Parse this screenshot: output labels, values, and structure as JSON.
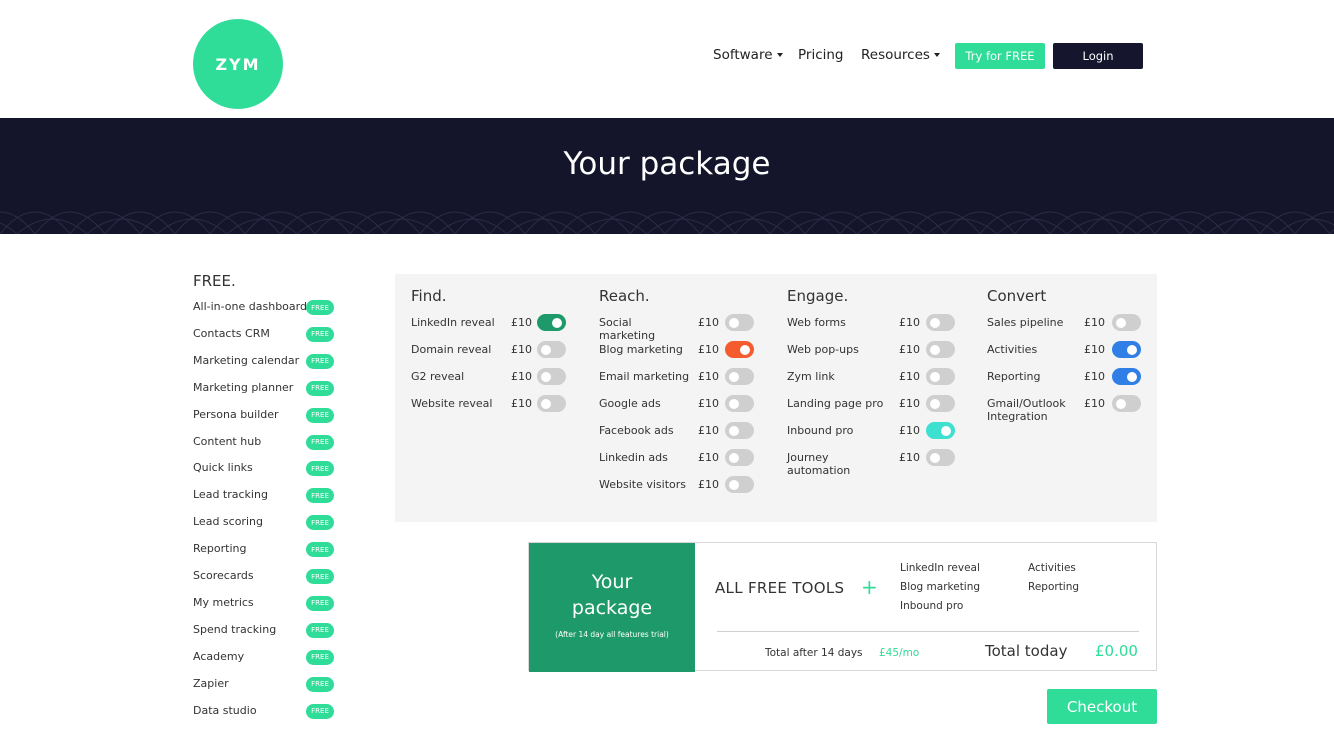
{
  "header": {
    "logo_text": "ZYM",
    "nav": {
      "software": "Software",
      "pricing": "Pricing",
      "resources": "Resources"
    },
    "try_button": "Try for FREE",
    "login_button": "Login"
  },
  "banner": {
    "title": "Your package"
  },
  "free": {
    "title": "FREE.",
    "badge": "FREE",
    "items": [
      "All-in-one dashboard",
      "Contacts CRM",
      "Marketing calendar",
      "Marketing planner",
      "Persona builder",
      "Content hub",
      "Quick links",
      "Lead tracking",
      "Lead scoring",
      "Reporting",
      "Scorecards",
      "My metrics",
      "Spend tracking",
      "Academy",
      "Zapier",
      "Data studio"
    ]
  },
  "columns": [
    {
      "title": "Find.",
      "tools": [
        {
          "label": "LinkedIn reveal",
          "price": "£10",
          "on": true,
          "color": "#1e9a6a"
        },
        {
          "label": "Domain reveal",
          "price": "£10",
          "on": false,
          "color": "#cfcfcf"
        },
        {
          "label": "G2 reveal",
          "price": "£10",
          "on": false,
          "color": "#cfcfcf"
        },
        {
          "label": "Website reveal",
          "price": "£10",
          "on": false,
          "color": "#cfcfcf"
        }
      ]
    },
    {
      "title": "Reach.",
      "tools": [
        {
          "label": "Social marketing",
          "price": "£10",
          "on": false,
          "color": "#cfcfcf"
        },
        {
          "label": "Blog marketing",
          "price": "£10",
          "on": true,
          "color": "#f45b2e"
        },
        {
          "label": "Email marketing",
          "price": "£10",
          "on": false,
          "color": "#cfcfcf"
        },
        {
          "label": "Google ads",
          "price": "£10",
          "on": false,
          "color": "#cfcfcf"
        },
        {
          "label": "Facebook ads",
          "price": "£10",
          "on": false,
          "color": "#cfcfcf"
        },
        {
          "label": "Linkedin ads",
          "price": "£10",
          "on": false,
          "color": "#cfcfcf"
        },
        {
          "label": "Website visitors",
          "price": "£10",
          "on": false,
          "color": "#cfcfcf"
        }
      ]
    },
    {
      "title": "Engage.",
      "tools": [
        {
          "label": "Web forms",
          "price": "£10",
          "on": false,
          "color": "#cfcfcf"
        },
        {
          "label": "Web pop-ups",
          "price": "£10",
          "on": false,
          "color": "#cfcfcf"
        },
        {
          "label": "Zym link",
          "price": "£10",
          "on": false,
          "color": "#cfcfcf"
        },
        {
          "label": "Landing page pro",
          "price": "£10",
          "on": false,
          "color": "#cfcfcf"
        },
        {
          "label": "Inbound pro",
          "price": "£10",
          "on": true,
          "color": "#3ee0d0"
        },
        {
          "label": "Journey automation",
          "price": "£10",
          "on": false,
          "color": "#cfcfcf"
        }
      ]
    },
    {
      "title": "Convert",
      "tools": [
        {
          "label": "Sales pipeline",
          "price": "£10",
          "on": false,
          "color": "#cfcfcf"
        },
        {
          "label": "Activities",
          "price": "£10",
          "on": true,
          "color": "#2f7fe6"
        },
        {
          "label": "Reporting",
          "price": "£10",
          "on": true,
          "color": "#2f7fe6"
        },
        {
          "label": "Gmail/Outlook Integration",
          "price": "£10",
          "on": false,
          "color": "#cfcfcf"
        }
      ]
    }
  ],
  "package": {
    "title_line1": "Your",
    "title_line2": "package",
    "subtitle": "(After 14 day all features trial)",
    "all_free": "ALL FREE TOOLS",
    "plus": "+",
    "selected_col1": [
      "LinkedIn reveal",
      "Blog marketing",
      "Inbound pro"
    ],
    "selected_col2": [
      "Activities",
      "Reporting"
    ],
    "after_label": "Total after 14 days",
    "after_value": "£45/mo",
    "today_label": "Total today",
    "today_value": "£0.00"
  },
  "checkout_button": "Checkout"
}
